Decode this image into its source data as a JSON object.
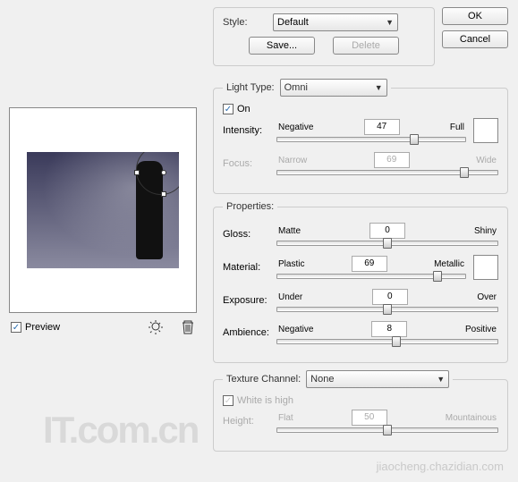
{
  "buttons": {
    "ok": "OK",
    "cancel": "Cancel",
    "save": "Save...",
    "delete": "Delete"
  },
  "style": {
    "label": "Style:",
    "value": "Default"
  },
  "lightType": {
    "legend": "Light Type:",
    "value": "Omni",
    "onLabel": "On"
  },
  "intensity": {
    "label": "Intensity:",
    "left": "Negative",
    "right": "Full",
    "value": "47"
  },
  "focus": {
    "label": "Focus:",
    "left": "Narrow",
    "right": "Wide",
    "value": "69"
  },
  "properties": {
    "legend": "Properties:"
  },
  "gloss": {
    "label": "Gloss:",
    "left": "Matte",
    "right": "Shiny",
    "value": "0"
  },
  "material": {
    "label": "Material:",
    "left": "Plastic",
    "right": "Metallic",
    "value": "69"
  },
  "exposure": {
    "label": "Exposure:",
    "left": "Under",
    "right": "Over",
    "value": "0"
  },
  "ambience": {
    "label": "Ambience:",
    "left": "Negative",
    "right": "Positive",
    "value": "8"
  },
  "texture": {
    "legend": "Texture Channel:",
    "value": "None",
    "whiteHigh": "White is high"
  },
  "height": {
    "label": "Height:",
    "left": "Flat",
    "right": "Mountainous",
    "value": "50"
  },
  "preview": {
    "label": "Preview"
  },
  "watermark": "IT.com.cn",
  "watermark2": "jiaocheng.chazidian.com"
}
